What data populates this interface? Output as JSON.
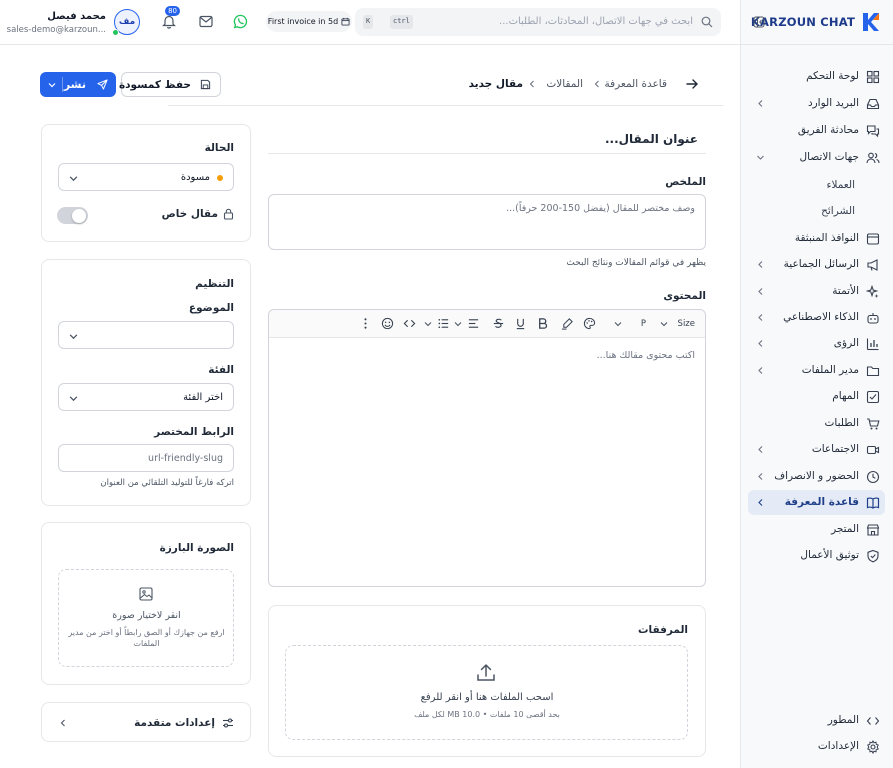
{
  "brand": {
    "name": "KARZOUN CHAT"
  },
  "sidebar": {
    "items": [
      {
        "label": "لوحة التحكم",
        "icon": "dashboard-icon"
      },
      {
        "label": "البريد الوارد",
        "icon": "inbox-icon"
      },
      {
        "label": "محادثة الفريق",
        "icon": "team-chat-icon"
      },
      {
        "label": "جهات الاتصال",
        "icon": "contacts-icon"
      },
      {
        "label": "النوافذ المنبثقة",
        "icon": "popup-icon"
      },
      {
        "label": "الرسائل الجماعية",
        "icon": "megaphone-icon"
      },
      {
        "label": "الأتمتة",
        "icon": "sparkles-icon"
      },
      {
        "label": "الذكاء الاصطناعي",
        "icon": "bot-icon"
      },
      {
        "label": "الرؤى",
        "icon": "chart-icon"
      },
      {
        "label": "مدير الملفات",
        "icon": "folder-icon"
      },
      {
        "label": "المهام",
        "icon": "tasks-icon"
      },
      {
        "label": "الطلبات",
        "icon": "cart-icon"
      },
      {
        "label": "الاجتماعات",
        "icon": "video-icon"
      },
      {
        "label": "الحضور و الانصراف",
        "icon": "clock-icon"
      },
      {
        "label": "قاعدة المعرفة",
        "icon": "book-icon"
      },
      {
        "label": "المتجر",
        "icon": "store-icon"
      },
      {
        "label": "توثيق الأعمال",
        "icon": "shield-icon"
      }
    ],
    "contacts_sub": [
      "العملاء",
      "الشرائح"
    ],
    "footer": [
      {
        "label": "المطور",
        "icon": "code-icon"
      },
      {
        "label": "الإعدادات",
        "icon": "gear-icon"
      }
    ]
  },
  "topbar": {
    "search_placeholder": "ابحث في جهات الاتصال، المحادثات، الطلبات...",
    "shortcut_ctrl": "ctrl",
    "shortcut_k": "K",
    "invoice_pill": "First invoice in 5d",
    "notifications_count": "80",
    "user_initials": "مف",
    "user_name": "محمد فيصل",
    "user_email": "sales-demo@karzoun..."
  },
  "breadcrumb": {
    "items": [
      "قاعدة المعرفة",
      "المقالات",
      "مقال جديد"
    ]
  },
  "actions": {
    "publish": "نشر",
    "save_draft": "حفظ كمسودة"
  },
  "editor": {
    "title_placeholder": "عنوان المقال...",
    "summary_label": "الملخص",
    "summary_placeholder": "وصف مختصر للمقال (يفضل 150-200 حرفاً)...",
    "summary_hint": "يظهر في قوائم المقالات ونتائج البحث",
    "content_label": "المحتوى",
    "content_placeholder": "اكتب محتوى مقالك هنا...",
    "toolbar_size": "Size",
    "toolbar_paragraph": "P"
  },
  "attachments": {
    "title": "المرفقات",
    "drop_text": "اسحب الملفات هنا أو انقر للرفع",
    "limits": "بحد أقصى 10 ملفات • 10.0 MB لكل ملف"
  },
  "status_card": {
    "label": "الحالة",
    "value": "مسودة",
    "private_label": "مقال خاص",
    "private_on": false
  },
  "organize_card": {
    "title": "التنظيم",
    "topic_label": "الموضوع",
    "topic_value": "",
    "category_label": "الفئة",
    "category_value": "اختر الفئة",
    "slug_label": "الرابط المختصر",
    "slug_placeholder": "url-friendly-slug",
    "slug_hint": "اتركه فارغاً للتوليد التلقائي من العنوان"
  },
  "featured_image": {
    "title": "الصورة البارزة",
    "click_text": "انقر لاختيار صورة",
    "hint": "ارفع من جهازك أو الصق رابطاً أو اختر من مدير الملفات"
  },
  "advanced": {
    "label": "إعدادات متقدمة"
  },
  "colors": {
    "accent": "#2563eb",
    "status_draft": "#f59e0b",
    "active_bg": "#e4ebf6"
  }
}
